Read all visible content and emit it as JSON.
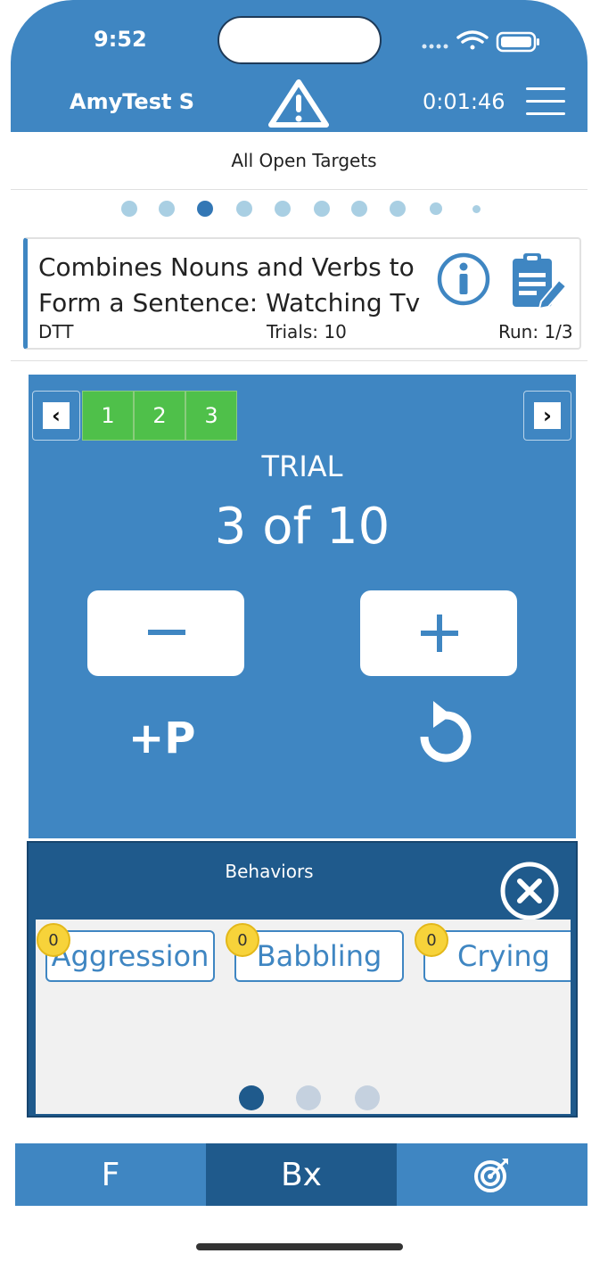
{
  "status_bar": {
    "time": "9:52"
  },
  "header": {
    "user_name": "AmyTest S",
    "session_timer": "0:01:46"
  },
  "subtitle": "All Open Targets",
  "pager": {
    "count": 10,
    "active_index": 2
  },
  "target_card": {
    "title": "Combines Nouns and Verbs to Form a Sentence: Watching Tv",
    "type": "DTT",
    "trials": "Trials: 10",
    "run": "Run: 1/3"
  },
  "trial_panel": {
    "completed_trials": [
      "1",
      "2",
      "3"
    ],
    "trial_label": "TRIAL",
    "trial_count": "3 of 10",
    "minus_label": "−",
    "plus_label": "+",
    "prompt_label": "+P"
  },
  "behaviors": {
    "title": "Behaviors",
    "items": [
      {
        "name": "Aggression",
        "count": "0"
      },
      {
        "name": "Babbling",
        "count": "0"
      },
      {
        "name": "Crying",
        "count": "0"
      }
    ],
    "pages": 3,
    "active_page": 0
  },
  "tabs": [
    {
      "label": "F"
    },
    {
      "label": "Bx"
    },
    {
      "label": ""
    }
  ],
  "colors": {
    "primary": "#3f86c2",
    "dark": "#1f5a8c",
    "success": "#4fc04a",
    "badge": "#f7d33a"
  }
}
